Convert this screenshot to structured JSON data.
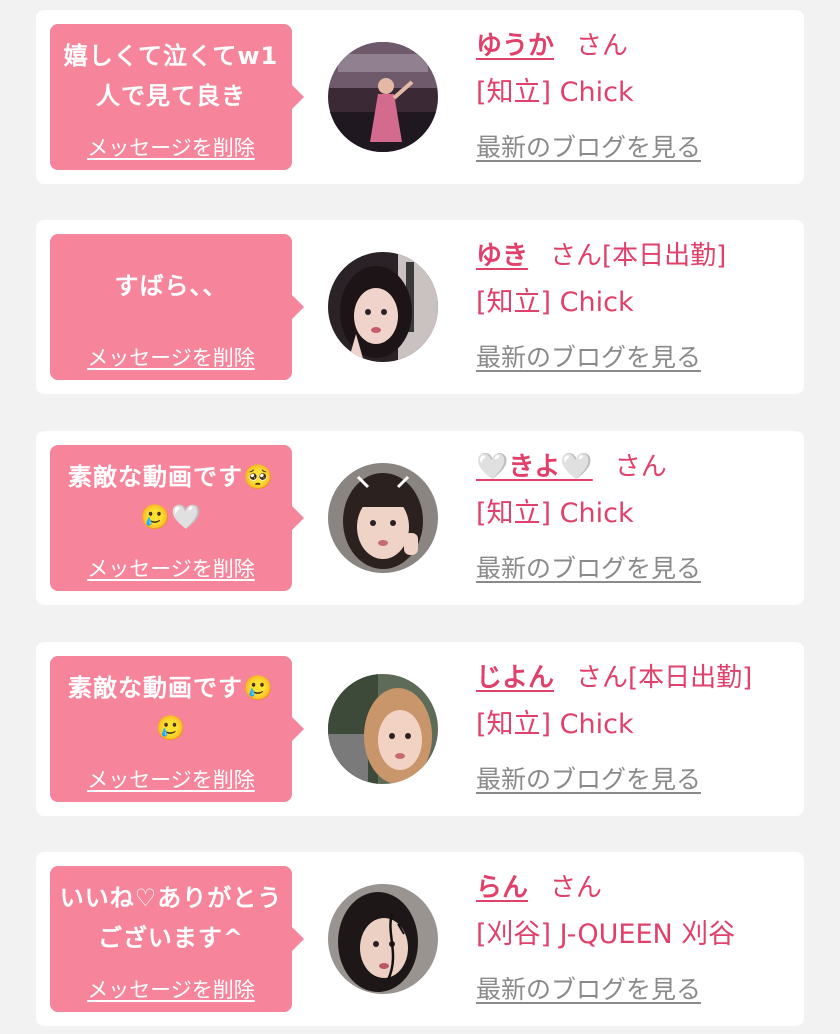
{
  "messages": [
    {
      "text": "嬉しくて泣くてw1人で見て良き",
      "delete_label": "メッセージを削除",
      "name": "ゆうか",
      "suffix": "さん",
      "shop": "[知立] Chick",
      "blog_label": "最新のブログを見る"
    },
    {
      "text": "すばら、、",
      "delete_label": "メッセージを削除",
      "name": "ゆき",
      "suffix": "さん[本日出勤]",
      "shop": "[知立] Chick",
      "blog_label": "最新のブログを見る"
    },
    {
      "text": "素敵な動画です🥺🥲🤍",
      "delete_label": "メッセージを削除",
      "name": "🤍きよ🤍",
      "suffix": "さん",
      "shop": "[知立] Chick",
      "blog_label": "最新のブログを見る"
    },
    {
      "text": "素敵な動画です🥲🥲",
      "delete_label": "メッセージを削除",
      "name": "じよん",
      "suffix": "さん[本日出勤]",
      "shop": "[知立] Chick",
      "blog_label": "最新のブログを見る"
    },
    {
      "text": "いいね♡ありがとうございます^",
      "delete_label": "メッセージを削除",
      "name": "らん",
      "suffix": "さん",
      "shop": "[刈谷] J-QUEEN 刈谷",
      "blog_label": "最新のブログを見る"
    }
  ],
  "colors": {
    "page_bg": "#f2f2f2",
    "card_bg": "#ffffff",
    "bubble_bg": "#f6849a",
    "accent": "#e0406a",
    "muted_link": "#8a8a8a"
  }
}
